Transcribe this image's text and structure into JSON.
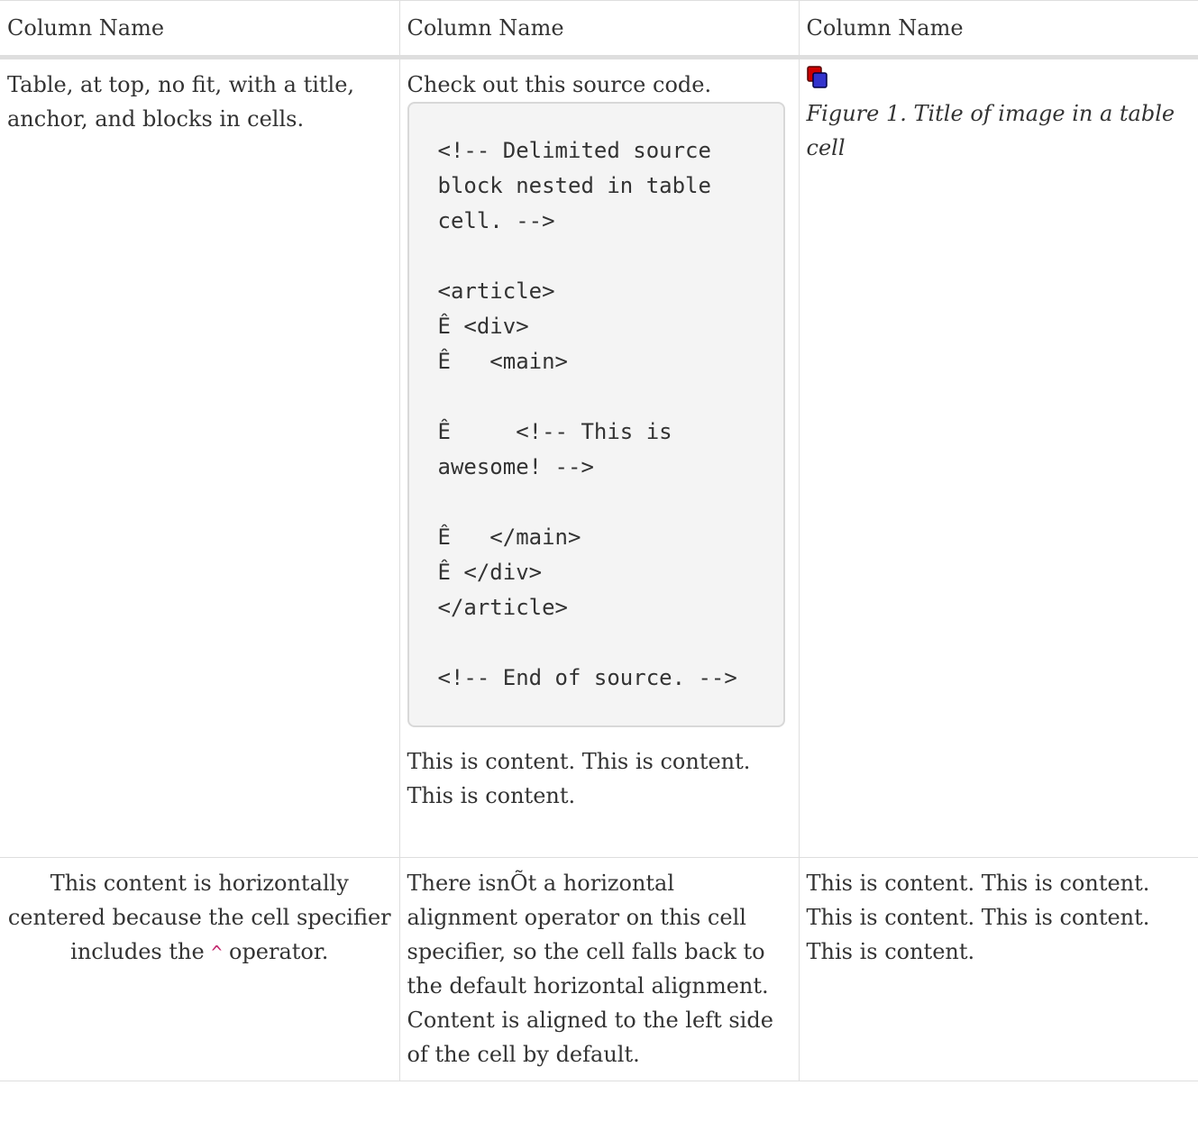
{
  "table": {
    "headers": [
      "Column Name",
      "Column Name",
      "Column Name"
    ],
    "row1": {
      "col1": "Table, at top, no fit, with a title, anchor, and blocks in cells.",
      "col2_intro": "Check out this source code.",
      "code": "<!-- Delimited source block nested in table cell. -->\n\n<article>\nÊ <div>\nÊ   <main>\n\nÊ     <!-- This is awesome! -->\n\nÊ   </main>\nÊ </div>\n</article>\n\n<!-- End of source. -->",
      "col2_outro": "This is content. This is content. This is content.",
      "figure_title": "Figure 1. Title of image in a table cell"
    },
    "row2": {
      "col1_before": "This content is horizontally centered because the cell specifier includes the ",
      "col1_operator": "^",
      "col1_after": " operator.",
      "col2": "There isnÕt a horizontal alignment operator on this cell specifier, so the cell falls back to the default horizontal alignment. Content is aligned to the left side of the cell by default.",
      "col3": "This is content. This is content. This is content. This is content. This is content."
    }
  },
  "colors": {
    "text": "#333333",
    "border": "#dedede",
    "code_background": "#f4f4f4",
    "operator": "#c2246b",
    "image_red": "#cc0000",
    "image_blue": "#3333cc"
  },
  "icons": {
    "figure_image": "overlapping-squares-icon"
  }
}
